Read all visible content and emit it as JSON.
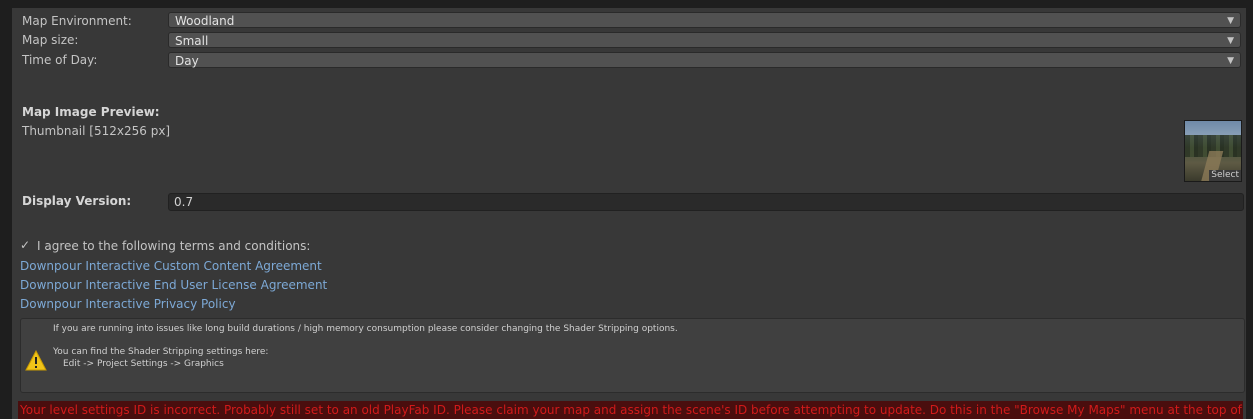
{
  "fields": {
    "map_environment": {
      "label": "Map Environment:",
      "value": "Woodland"
    },
    "map_size": {
      "label": "Map size:",
      "value": "Small"
    },
    "time_of_day": {
      "label": "Time of Day:",
      "value": "Day"
    }
  },
  "preview": {
    "heading": "Map Image Preview:",
    "thumbnail_label": "Thumbnail [512x256 px]",
    "select_label": "Select"
  },
  "version": {
    "label": "Display Version:",
    "value": "0.7"
  },
  "terms": {
    "checkbox_label": "I agree to the following terms and conditions:",
    "checked": true,
    "links": [
      "Downpour Interactive Custom Content Agreement",
      "Downpour Interactive End User License Agreement",
      "Downpour Interactive Privacy Policy"
    ]
  },
  "helpbox": {
    "line1": "If you are running into issues like long build durations / high memory consumption please consider changing the Shader Stripping options.",
    "line2": "You can find the Shader Stripping settings here:",
    "line3": "Edit -> Project Settings -> Graphics"
  },
  "error": "Your level settings ID is incorrect. Probably still set to an old PlayFab ID. Please claim your map and assign the scene's ID before attempting to update. Do this in the \"Browse My Maps\" menu at the top of this page!",
  "colors": {
    "background": "#383838",
    "link": "#7da9d6",
    "error_text": "#d11a1a",
    "warning_icon": "#f0c419"
  }
}
